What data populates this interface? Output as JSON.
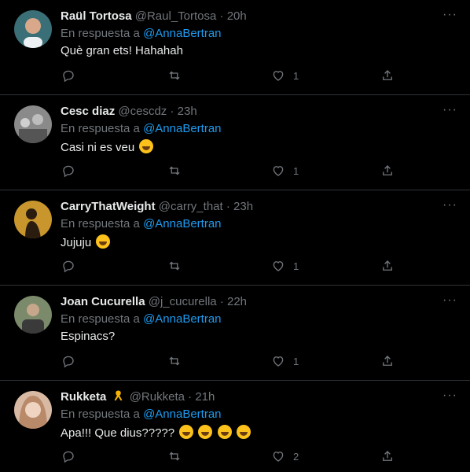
{
  "more_label": "···",
  "tweets": [
    {
      "name": "Raül Tortosa",
      "handle": "@Raul_Tortosa",
      "dot": "·",
      "time": "20h",
      "reply_prefix": "En respuesta a",
      "reply_mention": "@AnnaBertran",
      "text": "Què gran ets! Hahahah",
      "emoji": [],
      "like_count": "1",
      "avatar_color": "#3b6f77"
    },
    {
      "name": "Cesc diaz",
      "handle": "@cescdz",
      "dot": "·",
      "time": "23h",
      "reply_prefix": "En respuesta a",
      "reply_mention": "@AnnaBertran",
      "text": "Casi ni es veu",
      "emoji": [
        "rolling-on-floor-laughing"
      ],
      "like_count": "1",
      "avatar_color": "#8a8a8a"
    },
    {
      "name": "CarryThatWeight",
      "handle": "@carry_that",
      "dot": "·",
      "time": "23h",
      "reply_prefix": "En respuesta a",
      "reply_mention": "@AnnaBertran",
      "text": "Jujuju",
      "emoji": [
        "face-with-hand-over-mouth"
      ],
      "like_count": "1",
      "avatar_color": "#c9962e"
    },
    {
      "name": "Joan Cucurella",
      "handle": "@j_cucurella",
      "dot": "·",
      "time": "22h",
      "reply_prefix": "En respuesta a",
      "reply_mention": "@AnnaBertran",
      "text": "Espinacs?",
      "emoji": [],
      "like_count": "1",
      "avatar_color": "#7a8a6a"
    },
    {
      "name": "Rukketa",
      "handle": "@Rukketa",
      "dot": "·",
      "time": "21h",
      "reply_prefix": "En respuesta a",
      "reply_mention": "@AnnaBertran",
      "text": "Apa!!! Que dius?????",
      "emoji": [
        "grinning-sweat",
        "grinning-sweat",
        "grinning-sweat",
        "grinning-sweat"
      ],
      "like_count": "2",
      "avatar_color": "#d8b9a4"
    }
  ]
}
